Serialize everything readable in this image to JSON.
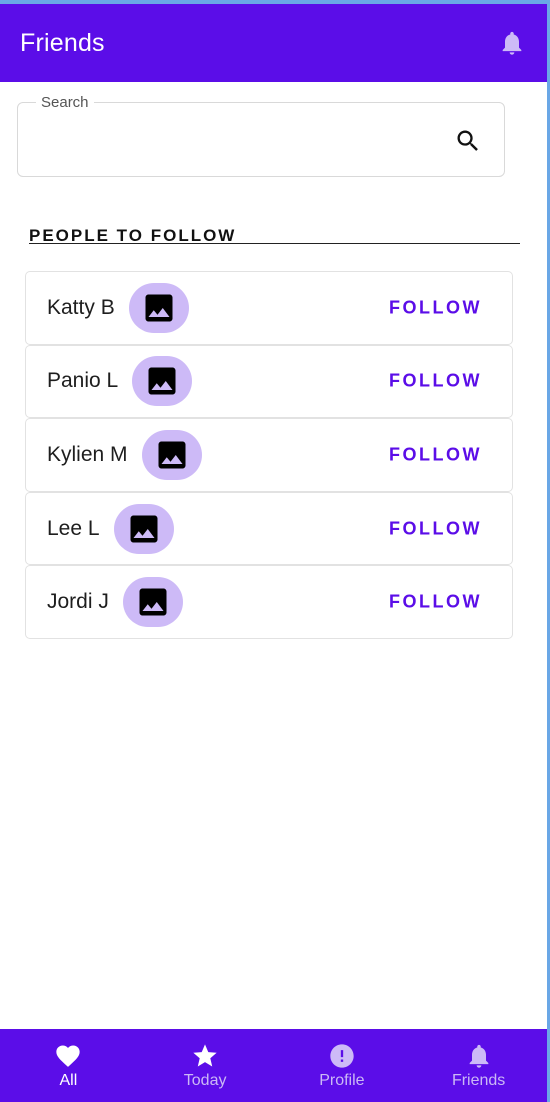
{
  "app_bar": {
    "title": "Friends",
    "bell_icon": "bell-icon"
  },
  "search": {
    "label": "Search",
    "value": "",
    "placeholder": "",
    "icon": "search-icon"
  },
  "section": {
    "title": "PEOPLE TO FOLLOW"
  },
  "people": [
    {
      "name": "Katty B",
      "action": "FOLLOW"
    },
    {
      "name": "Panio L",
      "action": "FOLLOW"
    },
    {
      "name": "Kylien M",
      "action": "FOLLOW"
    },
    {
      "name": "Lee L",
      "action": "FOLLOW"
    },
    {
      "name": "Jordi J",
      "action": "FOLLOW"
    }
  ],
  "bottom_nav": {
    "items": [
      {
        "label": "All",
        "icon": "heart-icon",
        "active": true
      },
      {
        "label": "Today",
        "icon": "star-icon",
        "active": false
      },
      {
        "label": "Profile",
        "icon": "alert-circle-icon",
        "active": false
      },
      {
        "label": "Friends",
        "icon": "bell-icon",
        "active": false
      }
    ]
  },
  "colors": {
    "primary": "#5b0de8",
    "avatar_bg": "#cdbaf7",
    "inactive_nav": "#cbb8f5"
  }
}
